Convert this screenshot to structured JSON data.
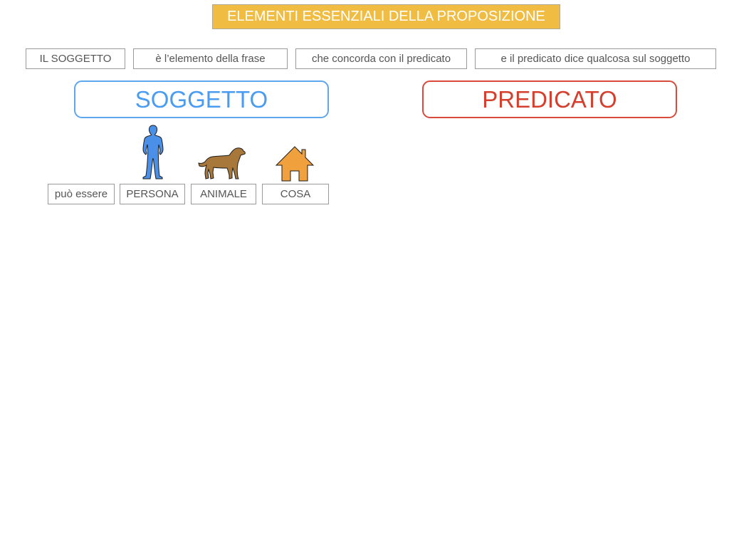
{
  "slide": {
    "title": "ELEMENTI ESSENZIALI DELLA PROPOSIZIONE",
    "title_color": "#f0bc42"
  },
  "definition": {
    "parts": [
      "IL SOGGETTO",
      "è l’elemento della frase",
      "che concorda con il predicato",
      "e il predicato dice qualcosa sul soggetto"
    ]
  },
  "categories": {
    "subject": {
      "label": "SOGGETTO",
      "color": "#4a9cf0"
    },
    "predicate": {
      "label": "PREDICATO",
      "color": "#d43f2e"
    }
  },
  "subject_types": {
    "intro": "può essere",
    "items": [
      {
        "label": "PERSONA",
        "icon": "person-icon",
        "color": "#4a90e8"
      },
      {
        "label": "ANIMALE",
        "icon": "dog-icon",
        "color": "#a8773a"
      },
      {
        "label": "COSA",
        "icon": "house-icon",
        "color": "#f0a03c"
      }
    ]
  }
}
